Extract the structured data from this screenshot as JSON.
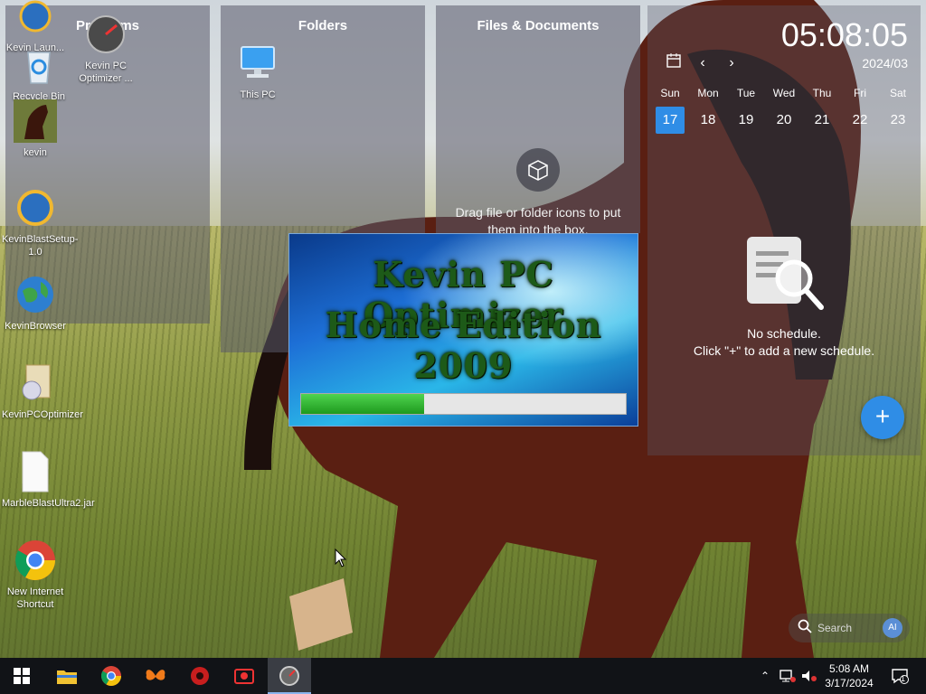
{
  "panels": {
    "programs": {
      "title": "Programs"
    },
    "folders": {
      "title": "Folders",
      "items": [
        {
          "label": "This PC",
          "icon": "monitor-icon"
        }
      ]
    },
    "files": {
      "title": "Files & Documents",
      "hint": "Drag file or folder icons to put them into the box."
    }
  },
  "clock": {
    "time": "05:08:05",
    "month": "2024/03",
    "days": [
      {
        "name": "Sun",
        "date": "17",
        "today": true
      },
      {
        "name": "Mon",
        "date": "18"
      },
      {
        "name": "Tue",
        "date": "19"
      },
      {
        "name": "Wed",
        "date": "20"
      },
      {
        "name": "Thu",
        "date": "21"
      },
      {
        "name": "Fri",
        "date": "22"
      },
      {
        "name": "Sat",
        "date": "23"
      }
    ]
  },
  "schedule": {
    "empty_line1": "No schedule.",
    "empty_line2": "Click \"+\" to add a new schedule.",
    "add_label": "+"
  },
  "search": {
    "placeholder": "Search",
    "ai_label": "AI"
  },
  "desktop_icons": [
    {
      "label": "Kevin Laun...",
      "icon": "kevin-launcher-icon"
    },
    {
      "label": "Kevin PC Optimizer ...",
      "icon": "optimizer-shortcut-icon"
    },
    {
      "label": "Recycle Bin",
      "icon": "recycle-bin-icon"
    },
    {
      "label": "kevin",
      "icon": "horse-image-icon"
    },
    {
      "label": "KevinBlastSetup-1.0",
      "icon": "setup-icon"
    },
    {
      "label": "KevinBrowser",
      "icon": "globe-icon"
    },
    {
      "label": "KevinPCOptimizer",
      "icon": "installer-icon"
    },
    {
      "label": "MarbleBlastUltra2.jar",
      "icon": "file-icon"
    },
    {
      "label": "New Internet Shortcut",
      "icon": "chrome-shortcut-icon"
    }
  ],
  "splash": {
    "line1": "Kevin PC Optimizer",
    "line2": "Home Edition 2009",
    "progress": 0.38
  },
  "taskbar": {
    "apps": [
      "start-icon",
      "file-explorer-icon",
      "chrome-icon",
      "butterfly-icon",
      "gear-app-icon",
      "camera-app-icon",
      "optimizer-icon"
    ],
    "time": "5:08 AM",
    "date": "3/17/2024",
    "notifications": "1"
  },
  "colors": {
    "accent": "#2f8de6",
    "progress": "#2fb52f"
  }
}
